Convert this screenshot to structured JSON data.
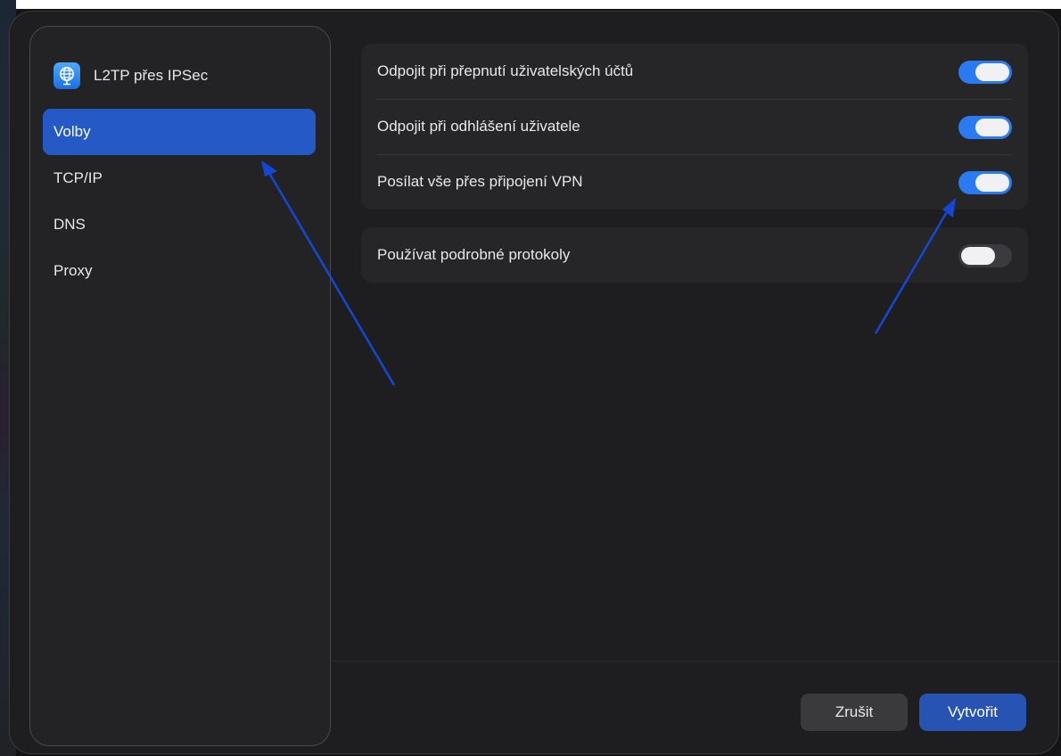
{
  "sidebar": {
    "title": "L2TP přes IPSec",
    "icon": "vpn-globe-icon",
    "items": [
      {
        "label": "Volby",
        "active": true
      },
      {
        "label": "TCP/IP",
        "active": false
      },
      {
        "label": "DNS",
        "active": false
      },
      {
        "label": "Proxy",
        "active": false
      }
    ]
  },
  "options": {
    "group1": [
      {
        "label": "Odpojit při přepnutí uživatelských účtů",
        "enabled": true
      },
      {
        "label": "Odpojit při odhlášení uživatele",
        "enabled": true
      },
      {
        "label": "Posílat vše přes připojení VPN",
        "enabled": true
      }
    ],
    "group2": [
      {
        "label": "Používat podrobné protokoly",
        "enabled": false
      }
    ]
  },
  "footer": {
    "cancel_label": "Zrušit",
    "create_label": "Vytvořit"
  },
  "colors": {
    "accent": "#2a7bf2",
    "selected_item": "#2459c6",
    "primary_button": "#2754b3",
    "annotation_arrow": "#1447d6"
  }
}
